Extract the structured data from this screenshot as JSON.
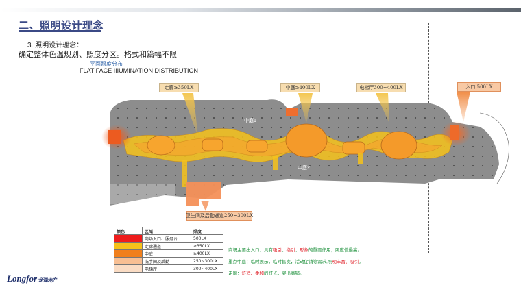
{
  "section": {
    "title": "二、照明设计理念",
    "number_line": "3. 照明设计理念：",
    "description": "确定整体色温规划、照度分区。格式和篇幅不限",
    "plan_title_cn": "平面照度分布",
    "plan_title_en": "FLAT FACE IIIUMINATION DISTRIBUTION"
  },
  "callouts": {
    "corridor": "走廊≥350LX",
    "atrium": "中庭≥400LX",
    "elevator": "电梯厅300~400LX",
    "entrance": "入口 500LX",
    "restroom": "卫生间及后勤通道250~300LX"
  },
  "area_labels": {
    "atrium1": "中庭1",
    "atrium2": "中庭2"
  },
  "legend": {
    "headers": [
      "颜色",
      "区域",
      "照度"
    ],
    "rows": [
      {
        "color": "#ee1c1c",
        "area": "商场入口、服务台",
        "lux": "500LX"
      },
      {
        "color": "#f6c21a",
        "area": "走廊通道",
        "lux": "≥350LX"
      },
      {
        "color": "#f07f1c",
        "area": "中庭",
        "lux": "≥400LX"
      },
      {
        "color": "#f8bf93",
        "area": "洗手间及后勤",
        "lux": "250~300LX"
      },
      {
        "color": "#fadcc4",
        "area": "电梯厅",
        "lux": "300~400LX"
      }
    ]
  },
  "notes": {
    "line1_a": "商场主要出入口：具有",
    "line1_b": "吸引",
    "line1_c": "、",
    "line1_d": "指引",
    "line1_e": "、",
    "line1_f": "形象",
    "line1_g": "的重要作用，照度值最高。",
    "line2_a": "重点中庭：临时展示，临时售卖，活动促销等需求,照",
    "line2_b": "明丰富、吸引",
    "line2_c": "。",
    "line3_a": "走廊：",
    "line3_b": "舒适、柔和",
    "line3_c": "的灯光，突出商铺。"
  },
  "logo": {
    "brand": "Longfor",
    "cn": "龙湖地产"
  },
  "colors": {
    "accent": "#3b4a86",
    "corridor": "#f6c21a",
    "atrium": "#f07f1c",
    "entrance": "#ee1c1c"
  }
}
